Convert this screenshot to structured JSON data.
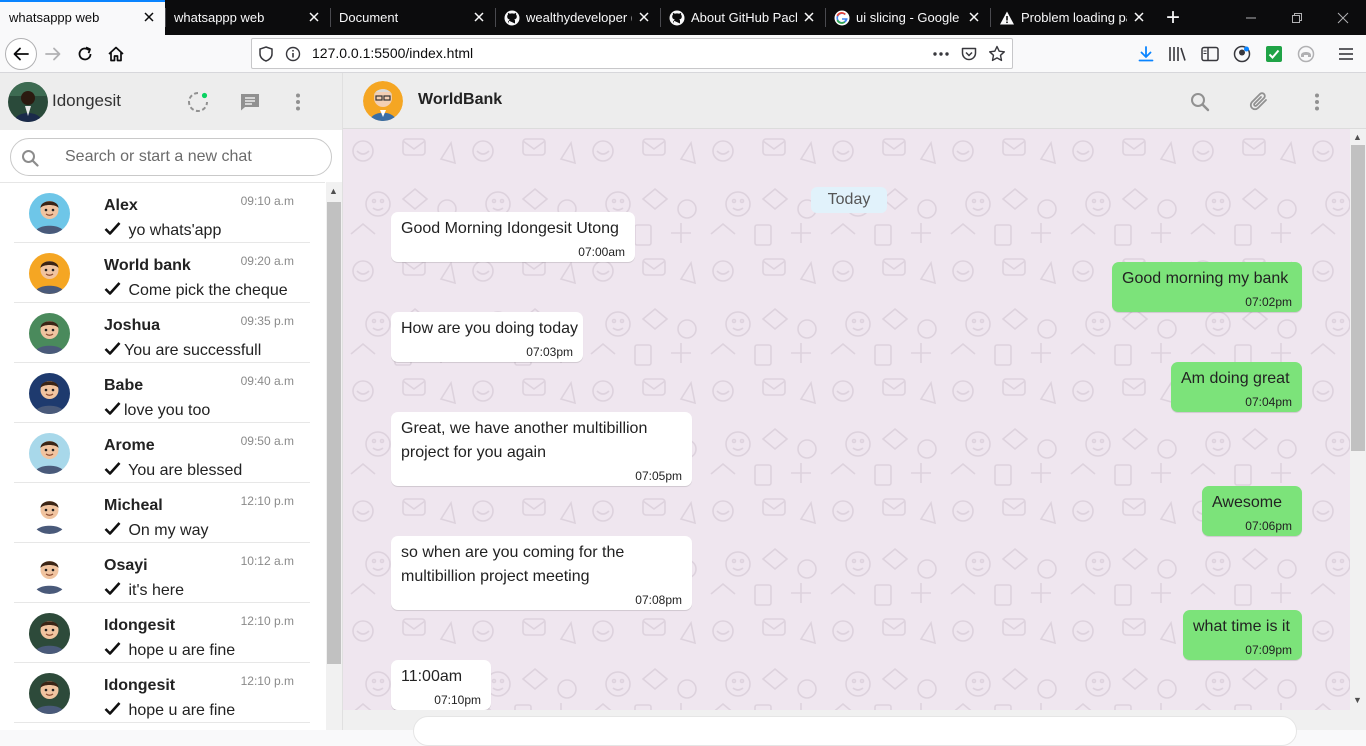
{
  "browser": {
    "tabs": [
      {
        "title": "whatsappp web",
        "active": true,
        "favicon": "none"
      },
      {
        "title": "whatsappp web",
        "active": false,
        "favicon": "none"
      },
      {
        "title": "Document",
        "active": false,
        "favicon": "none"
      },
      {
        "title": "wealthydeveloper (I",
        "active": false,
        "favicon": "github-icon"
      },
      {
        "title": "About GitHub Pack",
        "active": false,
        "favicon": "github-icon"
      },
      {
        "title": "ui slicing - Google S",
        "active": false,
        "favicon": "google-icon"
      },
      {
        "title": "Problem loading pa",
        "active": false,
        "favicon": "warning-icon"
      }
    ],
    "url": "127.0.0.1:5500/index.html"
  },
  "sidebar": {
    "user_name": "Idongesit",
    "search_placeholder": "Search or start a new chat",
    "chats": [
      {
        "name": "Alex",
        "time": "09:10 a.m",
        "message": " yo whats'app",
        "avatar_color": "#6ec6e8"
      },
      {
        "name": "World bank",
        "time": "09:20 a.m",
        "message": " Come pick the cheque",
        "avatar_color": "#f5a623"
      },
      {
        "name": "Joshua",
        "time": "09:35 p.m",
        "message": "You are successfull",
        "avatar_color": "#4a8a5c"
      },
      {
        "name": "Babe",
        "time": "09:40 a.m",
        "message": "love you too",
        "avatar_color": "#1e3a6e"
      },
      {
        "name": "Arome",
        "time": "09:50 a.m",
        "message": " You are blessed",
        "avatar_color": "#a8d8ea"
      },
      {
        "name": "Micheal",
        "time": "12:10 p.m",
        "message": " On my way",
        "avatar_color": "#ffffff"
      },
      {
        "name": "Osayi",
        "time": "10:12 a.m",
        "message": " it's here",
        "avatar_color": "#ffffff"
      },
      {
        "name": "Idongesit",
        "time": "12:10 p.m",
        "message": " hope u are fine",
        "avatar_color": "#2d4a3a"
      },
      {
        "name": "Idongesit",
        "time": "12:10 p.m",
        "message": " hope u are fine",
        "avatar_color": "#2d4a3a"
      }
    ]
  },
  "conversation": {
    "contact_name": "WorldBank",
    "day_label": "Today",
    "messages": [
      {
        "dir": "in",
        "lines": [
          "Good Morning Idongesit Utong"
        ],
        "time": "07:00am"
      },
      {
        "dir": "out",
        "lines": [
          "Good morning my bank"
        ],
        "time": "07:02pm"
      },
      {
        "dir": "in",
        "lines": [
          "How are you doing today"
        ],
        "time": "07:03pm"
      },
      {
        "dir": "out",
        "lines": [
          "Am doing great"
        ],
        "time": "07:04pm"
      },
      {
        "dir": "in",
        "lines": [
          "Great, we have another multibillion",
          "project for you again"
        ],
        "time": "07:05pm"
      },
      {
        "dir": "out",
        "lines": [
          "Awesome"
        ],
        "time": "07:06pm"
      },
      {
        "dir": "in",
        "lines": [
          "so when are you coming for the",
          "multibillion project meeting"
        ],
        "time": "07:08pm"
      },
      {
        "dir": "out",
        "lines": [
          "what time is it"
        ],
        "time": "07:09pm"
      },
      {
        "dir": "in",
        "lines": [
          "11:00am"
        ],
        "time": "07:10pm"
      }
    ]
  },
  "colors": {
    "accent_blue": "#0a84ff",
    "outgoing_bubble": "#7ce37a",
    "incoming_bubble": "#ffffff",
    "chat_background": "#efe6ef"
  }
}
